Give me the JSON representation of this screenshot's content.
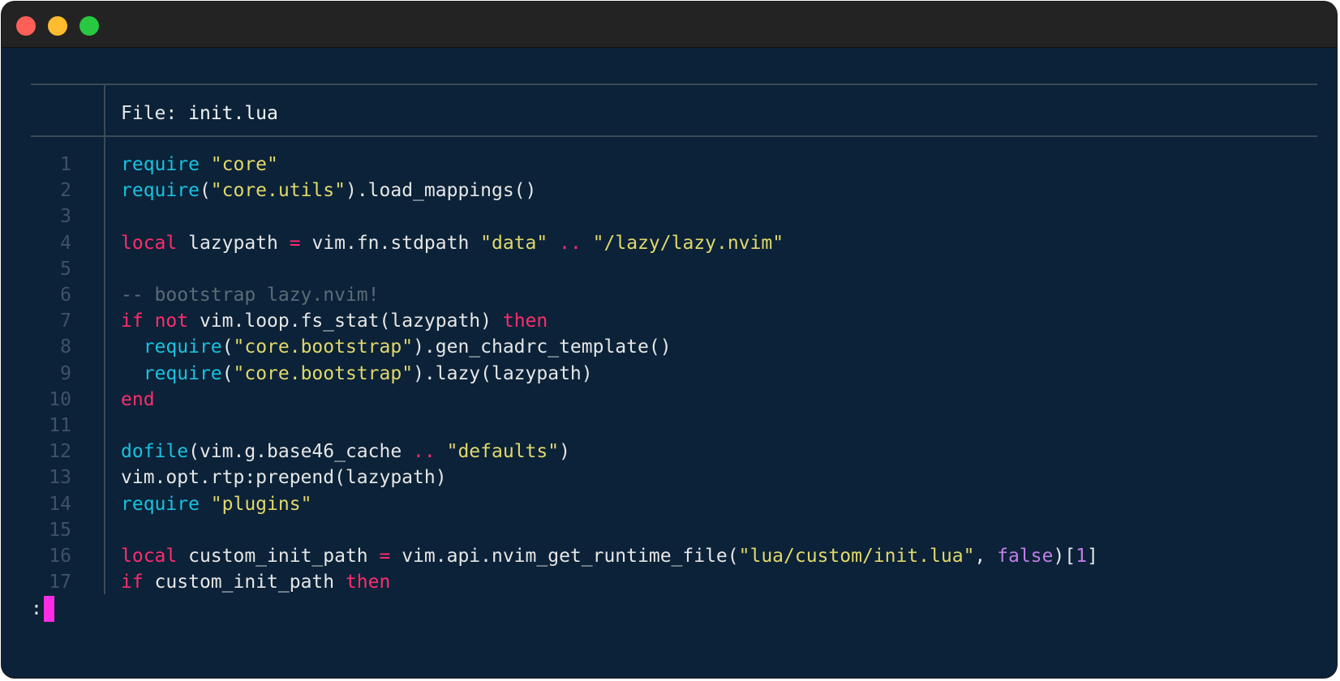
{
  "window": {
    "buttons": {
      "close": "close",
      "minimize": "minimize",
      "zoom": "zoom"
    }
  },
  "header": {
    "label": "File: ",
    "filename": "init.lua"
  },
  "colors": {
    "background": "#0b2238",
    "keyword": "#ff2c6d",
    "function": "#19c2e0",
    "string": "#e2d86a",
    "comment": "#5c6b77",
    "boolean": "#c17ee8",
    "cursor": "#ff2ce6"
  },
  "lines": [
    {
      "num": "1",
      "tokens": [
        {
          "t": "fn",
          "v": "require"
        },
        {
          "t": "pl",
          "v": " "
        },
        {
          "t": "str",
          "v": "\"core\""
        }
      ]
    },
    {
      "num": "2",
      "tokens": [
        {
          "t": "fn",
          "v": "require"
        },
        {
          "t": "pl",
          "v": "("
        },
        {
          "t": "str",
          "v": "\"core.utils\""
        },
        {
          "t": "pl",
          "v": ").load_mappings()"
        }
      ]
    },
    {
      "num": "3",
      "tokens": []
    },
    {
      "num": "4",
      "tokens": [
        {
          "t": "kw",
          "v": "local"
        },
        {
          "t": "pl",
          "v": " lazypath "
        },
        {
          "t": "op",
          "v": "="
        },
        {
          "t": "pl",
          "v": " vim.fn.stdpath "
        },
        {
          "t": "str",
          "v": "\"data\""
        },
        {
          "t": "pl",
          "v": " "
        },
        {
          "t": "op",
          "v": ".."
        },
        {
          "t": "pl",
          "v": " "
        },
        {
          "t": "str",
          "v": "\"/lazy/lazy.nvim\""
        }
      ]
    },
    {
      "num": "5",
      "tokens": []
    },
    {
      "num": "6",
      "tokens": [
        {
          "t": "cm",
          "v": "-- bootstrap lazy.nvim!"
        }
      ]
    },
    {
      "num": "7",
      "tokens": [
        {
          "t": "kw",
          "v": "if"
        },
        {
          "t": "pl",
          "v": " "
        },
        {
          "t": "kw",
          "v": "not"
        },
        {
          "t": "pl",
          "v": " vim.loop.fs_stat(lazypath) "
        },
        {
          "t": "kw",
          "v": "then"
        }
      ]
    },
    {
      "num": "8",
      "tokens": [
        {
          "t": "pl",
          "v": "  "
        },
        {
          "t": "fn",
          "v": "require"
        },
        {
          "t": "pl",
          "v": "("
        },
        {
          "t": "str",
          "v": "\"core.bootstrap\""
        },
        {
          "t": "pl",
          "v": ").gen_chadrc_template()"
        }
      ]
    },
    {
      "num": "9",
      "tokens": [
        {
          "t": "pl",
          "v": "  "
        },
        {
          "t": "fn",
          "v": "require"
        },
        {
          "t": "pl",
          "v": "("
        },
        {
          "t": "str",
          "v": "\"core.bootstrap\""
        },
        {
          "t": "pl",
          "v": ").lazy(lazypath)"
        }
      ]
    },
    {
      "num": "10",
      "tokens": [
        {
          "t": "kw",
          "v": "end"
        }
      ]
    },
    {
      "num": "11",
      "tokens": []
    },
    {
      "num": "12",
      "tokens": [
        {
          "t": "fn",
          "v": "dofile"
        },
        {
          "t": "pl",
          "v": "(vim.g.base46_cache "
        },
        {
          "t": "op",
          "v": ".."
        },
        {
          "t": "pl",
          "v": " "
        },
        {
          "t": "str",
          "v": "\"defaults\""
        },
        {
          "t": "pl",
          "v": ")"
        }
      ]
    },
    {
      "num": "13",
      "tokens": [
        {
          "t": "pl",
          "v": "vim.opt.rtp:prepend(lazypath)"
        }
      ]
    },
    {
      "num": "14",
      "tokens": [
        {
          "t": "fn",
          "v": "require"
        },
        {
          "t": "pl",
          "v": " "
        },
        {
          "t": "str",
          "v": "\"plugins\""
        }
      ]
    },
    {
      "num": "15",
      "tokens": []
    },
    {
      "num": "16",
      "tokens": [
        {
          "t": "kw",
          "v": "local"
        },
        {
          "t": "pl",
          "v": " custom_init_path "
        },
        {
          "t": "op",
          "v": "="
        },
        {
          "t": "pl",
          "v": " vim.api.nvim_get_runtime_file("
        },
        {
          "t": "str",
          "v": "\"lua/custom/init.lua\""
        },
        {
          "t": "pl",
          "v": ", "
        },
        {
          "t": "bool",
          "v": "false"
        },
        {
          "t": "pl",
          "v": ")["
        },
        {
          "t": "num",
          "v": "1"
        },
        {
          "t": "pl",
          "v": "]"
        }
      ]
    },
    {
      "num": "17",
      "tokens": [
        {
          "t": "kw",
          "v": "if"
        },
        {
          "t": "pl",
          "v": " custom_init_path "
        },
        {
          "t": "kw",
          "v": "then"
        }
      ]
    }
  ],
  "prompt": {
    "text": ":"
  }
}
